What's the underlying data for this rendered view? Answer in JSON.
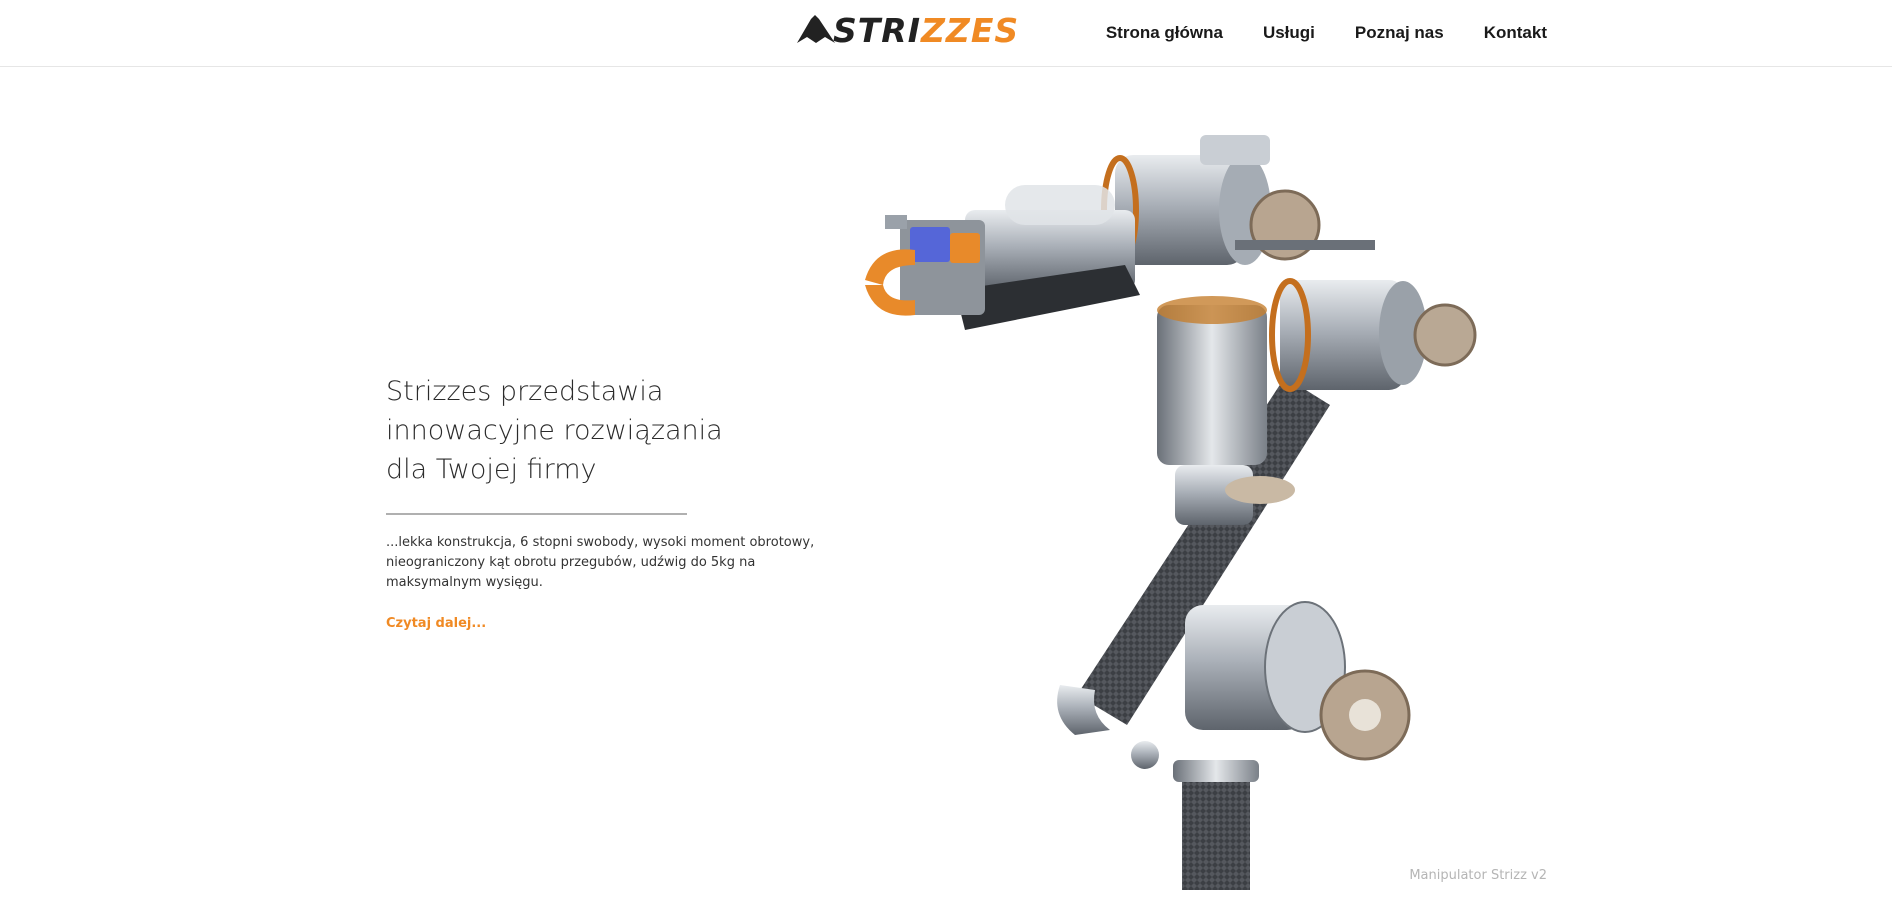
{
  "header": {
    "logo": {
      "part1": "STRI",
      "part2": "ZZES"
    },
    "nav": [
      {
        "label": "Strona główna"
      },
      {
        "label": "Usługi"
      },
      {
        "label": "Poznaj nas"
      },
      {
        "label": "Kontakt"
      }
    ]
  },
  "hero": {
    "title_lines": [
      "Strizzes przedstawia",
      "innowacyjne rozwiązania",
      "dla Twojej firmy"
    ],
    "description": "...lekka konstrukcja, 6 stopni swobody, wysoki moment obrotowy, nieograniczony kąt obrotu przegubów, udźwig do 5kg na maksymalnym wysięgu.",
    "read_more": "Czytaj dalej..."
  },
  "image": {
    "caption": "Manipulator Strizz v2",
    "icon": "robot-arm-illustration"
  },
  "colors": {
    "accent": "#f08a24",
    "text_dark": "#222222",
    "caption": "#b5b5b5"
  }
}
